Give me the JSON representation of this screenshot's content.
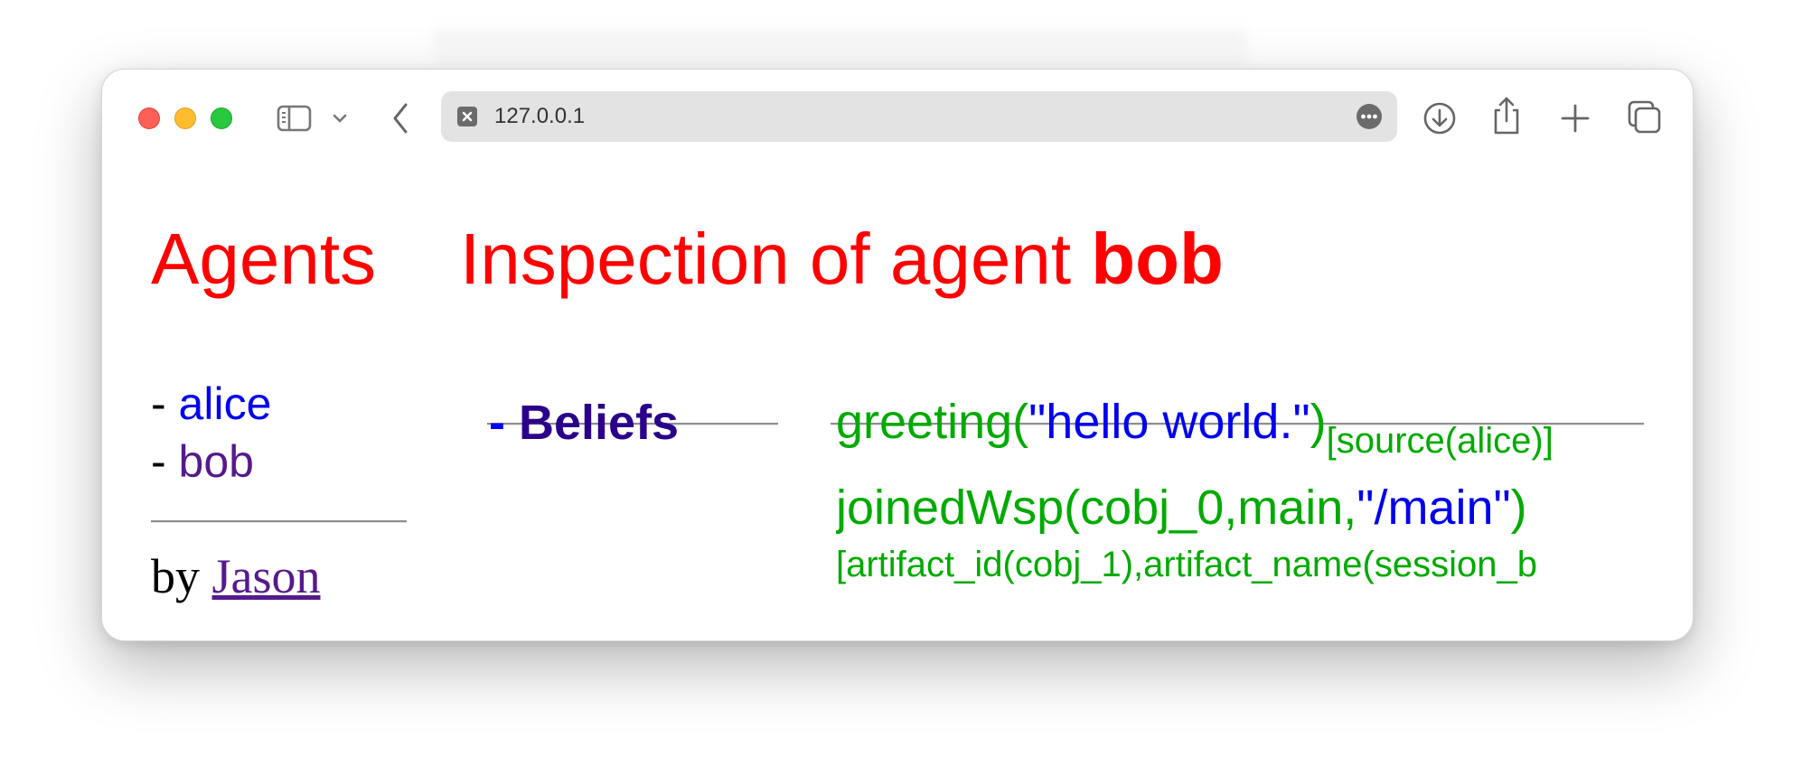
{
  "browser": {
    "url": "127.0.0.1",
    "icons": {
      "sidebar": "sidebar-icon",
      "chevron": "chevron-down-icon",
      "back": "back-arrow-icon",
      "favicon": "close-box-icon",
      "more": "ellipsis-circle-icon",
      "download": "download-icon",
      "share": "share-icon",
      "new_tab": "plus-icon",
      "tabs": "tab-overview-icon"
    },
    "colors": {
      "close": "#ff5f57",
      "minimize": "#febc2e",
      "zoom": "#28c840"
    }
  },
  "page": {
    "agents_heading": "Agents",
    "inspection_heading_prefix": "Inspection of agent ",
    "inspection_agent": "bob",
    "agents": [
      {
        "dash": "- ",
        "name": "alice",
        "color": "#0000ee"
      },
      {
        "dash": "- ",
        "name": "bob",
        "color": "#551a8b"
      }
    ],
    "by_label": "by ",
    "by_link": "Jason",
    "section_dash": "- ",
    "section_label": "Beliefs",
    "beliefs": [
      {
        "pre": "greeting(",
        "str": "\"hello world.\"",
        "post": ")",
        "annotation": "[source(alice)]"
      },
      {
        "pre": "joinedWsp(cobj_0,main,",
        "str": "\"/main\"",
        "post": ")",
        "annotation": "[artifact_id(cobj_1),artifact_name(session_b"
      }
    ],
    "colors": {
      "heading": "#ff0000",
      "belief_text": "#00aa00",
      "belief_string": "#0000ee",
      "section_label": "#2a008a",
      "link_visited": "#551a8b",
      "link_unvisited": "#0000ee"
    }
  }
}
